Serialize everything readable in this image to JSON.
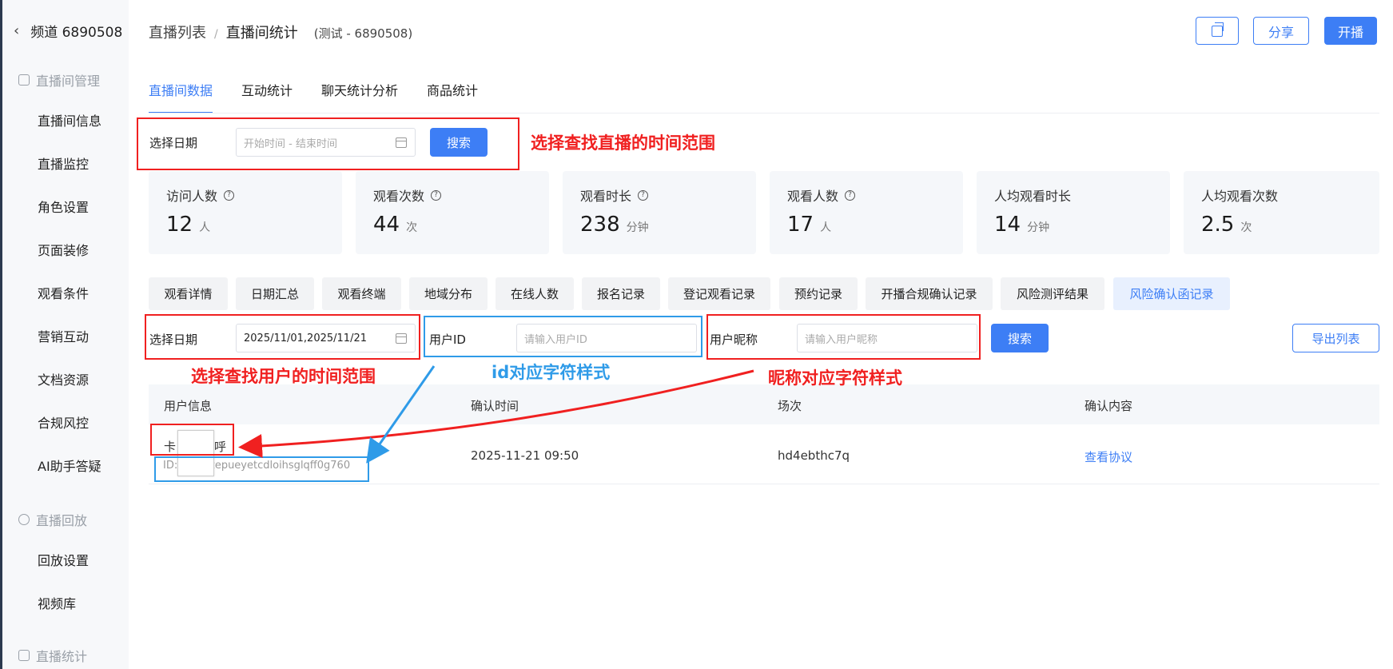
{
  "sidebar": {
    "back_title": "频道 6890508",
    "groups": [
      {
        "label": "直播间管理"
      },
      {
        "label": "直播回放"
      },
      {
        "label": "直播统计"
      }
    ],
    "items": [
      {
        "label": "直播间信息"
      },
      {
        "label": "直播监控"
      },
      {
        "label": "角色设置"
      },
      {
        "label": "页面装修"
      },
      {
        "label": "观看条件"
      },
      {
        "label": "营销互动"
      },
      {
        "label": "文档资源"
      },
      {
        "label": "合规风控"
      },
      {
        "label": "AI助手答疑"
      },
      {
        "label": "回放设置"
      },
      {
        "label": "视频库"
      }
    ]
  },
  "header": {
    "crumb_root": "直播列表",
    "crumb_sep": "/",
    "crumb_current": "直播间统计",
    "crumb_sub": "(测试 - 6890508)",
    "share_label": "分享",
    "start_label": "开播"
  },
  "tabs": [
    {
      "label": "直播间数据",
      "active": true
    },
    {
      "label": "互动统计"
    },
    {
      "label": "聊天统计分析"
    },
    {
      "label": "商品统计"
    }
  ],
  "filter1": {
    "label": "选择日期",
    "placeholder": "开始时间 - 结束时间",
    "search_label": "搜索"
  },
  "stats": [
    {
      "label": "访问人数",
      "value": "12",
      "unit": "人",
      "help": true
    },
    {
      "label": "观看次数",
      "value": "44",
      "unit": "次",
      "help": true
    },
    {
      "label": "观看时长",
      "value": "238",
      "unit": "分钟",
      "help": true
    },
    {
      "label": "观看人数",
      "value": "17",
      "unit": "人",
      "help": true
    },
    {
      "label": "人均观看时长",
      "value": "14",
      "unit": "分钟",
      "help": false
    },
    {
      "label": "人均观看次数",
      "value": "2.5",
      "unit": "次",
      "help": false
    }
  ],
  "subtabs": [
    {
      "label": "观看详情"
    },
    {
      "label": "日期汇总"
    },
    {
      "label": "观看终端"
    },
    {
      "label": "地域分布"
    },
    {
      "label": "在线人数"
    },
    {
      "label": "报名记录"
    },
    {
      "label": "登记观看记录"
    },
    {
      "label": "预约记录"
    },
    {
      "label": "开播合规确认记录"
    },
    {
      "label": "风险测评结果"
    },
    {
      "label": "风险确认函记录",
      "active": true
    }
  ],
  "filter2": {
    "date_label": "选择日期",
    "date_value": "2025/11/01,2025/11/21",
    "userid_label": "用户ID",
    "userid_placeholder": "请输入用户ID",
    "nick_label": "用户昵称",
    "nick_placeholder": "请输入用户昵称",
    "search_label": "搜索",
    "export_label": "导出列表"
  },
  "table": {
    "headers": [
      "用户信息",
      "确认时间",
      "场次",
      "确认内容"
    ],
    "rows": [
      {
        "name_left": "卡",
        "name_right": "呼",
        "id": "ID:    msogzepueyetcdloihsglqff0g760",
        "time": "2025-11-21 09:50",
        "session": "hd4ebthc7q",
        "action": "查看协议"
      }
    ]
  },
  "annotations": {
    "a1": "选择查找直播的时间范围",
    "a2": "选择查找用户的时间范围",
    "a3": "id对应字符样式",
    "a4": "昵称对应字符样式",
    "red": "#f02020",
    "blue": "#2f9be8"
  },
  "colors": {
    "accent": "#3d7ef5",
    "sidebar_bg": "#f7f8fa",
    "card_bg": "#f5f7fa"
  }
}
